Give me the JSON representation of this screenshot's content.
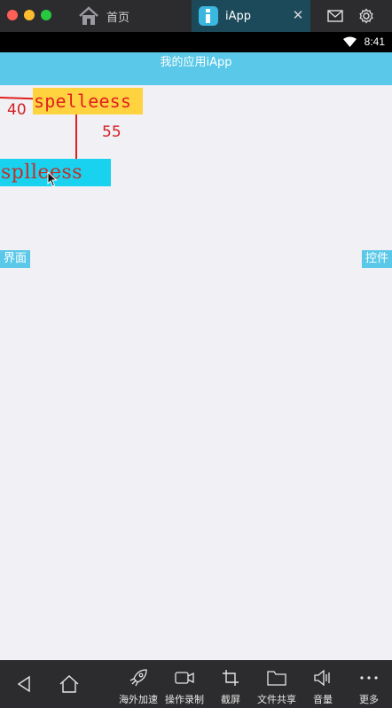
{
  "window": {
    "tabs": [
      {
        "label": "首页",
        "icon": "home-icon"
      },
      {
        "label": "iApp",
        "icon": "iapp-logo-icon"
      }
    ],
    "close_glyph": "✕"
  },
  "statusbar": {
    "time": "8:41"
  },
  "appbar": {
    "title": "我的应用iApp"
  },
  "canvas": {
    "yellow_label": "spelleess",
    "cyan_label": "splleess",
    "left_offset": "40",
    "top_offset": "55",
    "left_tag": "界面",
    "right_tag": "控件"
  },
  "bottombar": {
    "tools": [
      {
        "label": "海外加速",
        "icon": "rocket-icon"
      },
      {
        "label": "操作录制",
        "icon": "video-camera-icon"
      },
      {
        "label": "截屏",
        "icon": "crop-icon"
      },
      {
        "label": "文件共享",
        "icon": "folder-icon"
      },
      {
        "label": "音量",
        "icon": "speaker-icon"
      },
      {
        "label": "更多",
        "icon": "more-dots-icon"
      }
    ]
  },
  "colors": {
    "appbar": "#5ac8e8",
    "yellow_label_bg": "#ffd23f",
    "cyan_label_bg": "#19d2ef",
    "measure_red": "#e02020",
    "chrome_dark": "#2c2c2e"
  }
}
